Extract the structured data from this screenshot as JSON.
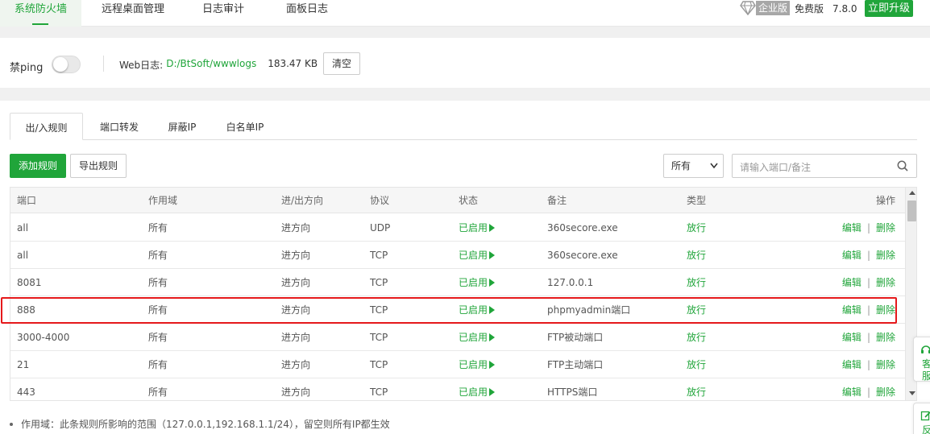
{
  "nav": {
    "tabs": [
      {
        "label": "系统防火墙",
        "active": true
      },
      {
        "label": "远程桌面管理",
        "active": false
      },
      {
        "label": "日志审计",
        "active": false
      },
      {
        "label": "面板日志",
        "active": false
      }
    ],
    "enterprise_label": "企业版",
    "edition": "免费版",
    "version": "7.8.0",
    "upgrade_label": "立即升级"
  },
  "ping": {
    "label": "禁ping",
    "enabled": false,
    "weblog_label": "Web日志:",
    "weblog_path": "D:/BtSoft/wwwlogs",
    "weblog_size": "183.47 KB",
    "clear_label": "清空"
  },
  "subtabs": [
    "出/入规则",
    "端口转发",
    "屏蔽IP",
    "白名单IP"
  ],
  "toolbar": {
    "add_label": "添加规则",
    "export_label": "导出规则",
    "filter_value": "所有",
    "search_placeholder": "请输入端口/备注"
  },
  "table": {
    "headers": [
      "端口",
      "作用域",
      "进/出方向",
      "协议",
      "状态",
      "备注",
      "类型",
      "操作"
    ],
    "rows": [
      {
        "port": "all",
        "scope": "所有",
        "direction": "进方向",
        "protocol": "UDP",
        "status": "已启用",
        "note": "360secore.exe",
        "type": "放行"
      },
      {
        "port": "all",
        "scope": "所有",
        "direction": "进方向",
        "protocol": "TCP",
        "status": "已启用",
        "note": "360secore.exe",
        "type": "放行"
      },
      {
        "port": "8081",
        "scope": "所有",
        "direction": "进方向",
        "protocol": "TCP",
        "status": "已启用",
        "note": "127.0.0.1",
        "type": "放行"
      },
      {
        "port": "888",
        "scope": "所有",
        "direction": "进方向",
        "protocol": "TCP",
        "status": "已启用",
        "note": "phpmyadmin端口",
        "type": "放行"
      },
      {
        "port": "3000-4000",
        "scope": "所有",
        "direction": "进方向",
        "protocol": "TCP",
        "status": "已启用",
        "note": "FTP被动端口",
        "type": "放行"
      },
      {
        "port": "21",
        "scope": "所有",
        "direction": "进方向",
        "protocol": "TCP",
        "status": "已启用",
        "note": "FTP主动端口",
        "type": "放行"
      },
      {
        "port": "443",
        "scope": "所有",
        "direction": "进方向",
        "protocol": "TCP",
        "status": "已启用",
        "note": "HTTPS端口",
        "type": "放行"
      }
    ],
    "edit_label": "编辑",
    "delete_label": "删除"
  },
  "note": "作用域：此条规则所影响的范围（127.0.0.1,192.168.1.1/24），留空则所有IP都生效",
  "float_buttons": [
    "客服",
    "反馈"
  ],
  "colors": {
    "accent": "#20a53a",
    "highlight": "#e5191b"
  }
}
